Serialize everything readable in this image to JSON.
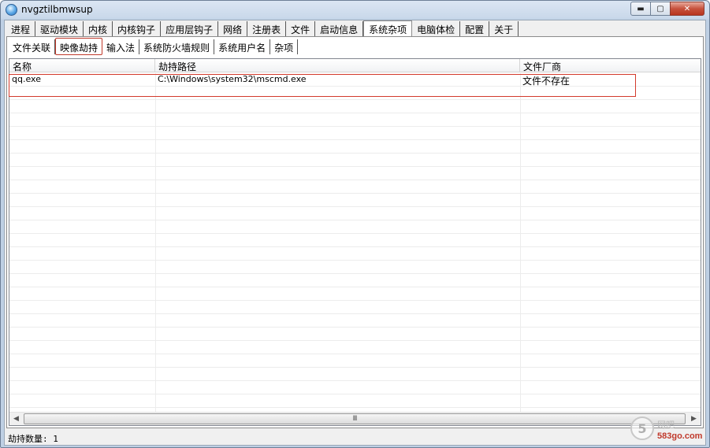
{
  "window": {
    "title": "nvgztilbmwsup",
    "minimize": "▬",
    "maximize": "▢",
    "close": "✕"
  },
  "tabs": [
    {
      "label": "进程"
    },
    {
      "label": "驱动模块"
    },
    {
      "label": "内核"
    },
    {
      "label": "内核钩子"
    },
    {
      "label": "应用层钩子"
    },
    {
      "label": "网络"
    },
    {
      "label": "注册表"
    },
    {
      "label": "文件"
    },
    {
      "label": "启动信息"
    },
    {
      "label": "系统杂项"
    },
    {
      "label": "电脑体检"
    },
    {
      "label": "配置"
    },
    {
      "label": "关于"
    }
  ],
  "subtabs": [
    {
      "label": "文件关联"
    },
    {
      "label": "映像劫持"
    },
    {
      "label": "输入法"
    },
    {
      "label": "系统防火墙规则"
    },
    {
      "label": "系统用户名"
    },
    {
      "label": "杂项"
    }
  ],
  "list": {
    "columns": [
      "名称",
      "劫持路径",
      "文件厂商"
    ],
    "rows": [
      {
        "name": "qq.exe",
        "path": "C:\\Windows\\system32\\mscmd.exe",
        "vendor": "文件不存在"
      }
    ]
  },
  "scrollbar": {
    "left_arrow": "◀",
    "right_arrow": "▶",
    "grip": "III"
  },
  "status": {
    "text": "劫持数量:  1"
  },
  "watermark": {
    "badge": "5",
    "top_text": "网吧",
    "site": "583go.com"
  }
}
